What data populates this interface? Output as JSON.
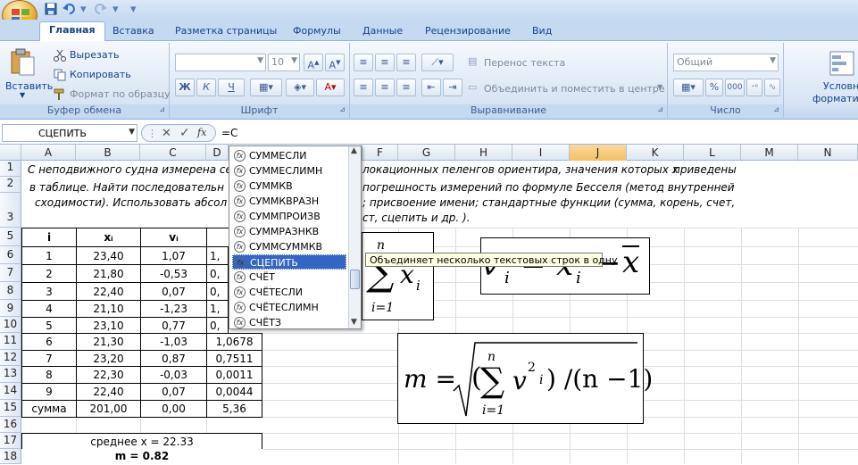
{
  "quick_access": {
    "save": "save-icon",
    "undo": "undo-icon",
    "redo": "redo-icon"
  },
  "tabs": [
    "Главная",
    "Вставка",
    "Разметка страницы",
    "Формулы",
    "Данные",
    "Рецензирование",
    "Вид"
  ],
  "ribbon": {
    "clipboard": {
      "paste": "Вставить",
      "cut": "Вырезать",
      "copy": "Копировать",
      "format_painter": "Формат по образцу",
      "label": "Буфер обмена"
    },
    "font": {
      "size": "10",
      "bold": "Ж",
      "italic": "К",
      "underline": "Ч",
      "label": "Шрифт"
    },
    "alignment": {
      "wrap": "Перенос текста",
      "merge": "Объединить и поместить в центре",
      "label": "Выравнивание"
    },
    "number": {
      "format": "Общий",
      "percent": "%",
      "thousands": "000",
      "label": "Число"
    },
    "styles": {
      "conditional_1": "Условно",
      "conditional_2": "форматиров"
    }
  },
  "formula_bar": {
    "name_box": "СЦЕПИТЬ",
    "content": "=С"
  },
  "columns": [
    "A",
    "B",
    "C",
    "D",
    "E",
    "F",
    "G",
    "H",
    "I",
    "J",
    "K",
    "L",
    "M",
    "N"
  ],
  "rows": [
    "1",
    "2",
    "3",
    "5",
    "6",
    "7",
    "8",
    "9",
    "10",
    "11",
    "12",
    "13",
    "14",
    "15",
    "16",
    "17",
    "18"
  ],
  "task_text": {
    "line1a": "С неподвижного судна измерена сер",
    "line1b": "локационных пеленгов ориентира, значения которых x",
    "line1c": " приведены",
    "line2a": "в таблице. Найти последовательн",
    "line2b": "погрешность измерений по формуле Бесселя (метод внутренней",
    "line3a": "сходимости). Использовать абсол",
    "line3b": "; присвоение имени; стандартные функции (сумма, корень, счет,",
    "line4": "ст, сцепить и др. )."
  },
  "table": {
    "headers": [
      "i",
      "xᵢ",
      "vᵢ"
    ],
    "rows": [
      [
        "1",
        "23,40",
        "1,07",
        "1,"
      ],
      [
        "2",
        "21,80",
        "-0,53",
        "0,"
      ],
      [
        "3",
        "22,40",
        "0,07",
        "0,"
      ],
      [
        "4",
        "21,10",
        "-1,23",
        "1,"
      ],
      [
        "5",
        "23,10",
        "0,77",
        "0,"
      ],
      [
        "6",
        "21,30",
        "-1,03",
        "1,0678"
      ],
      [
        "7",
        "23,20",
        "0,87",
        "0,7511"
      ],
      [
        "8",
        "22,30",
        "-0,03",
        "0,0011"
      ],
      [
        "9",
        "22,40",
        "0,07",
        "0,0044"
      ],
      [
        "сумма",
        "201,00",
        "0,00",
        "5,36"
      ]
    ],
    "mean": "среднее x = 22.33",
    "m": "m = 0.82"
  },
  "autocomplete": [
    "СУММЕСЛИ",
    "СУММЕСЛИМН",
    "СУММКВ",
    "СУММКВРАЗН",
    "СУММПРОИЗВ",
    "СУММРАЗНКВ",
    "СУММСУММКВ",
    "СЦЕПИТЬ",
    "СЧЁТ",
    "СЧЁТЕСЛИ",
    "СЧЁТЕСЛИМН",
    "СЧЁТЗ"
  ],
  "tooltip": "Объединяет несколько текстовых строк в одну",
  "formulas": {
    "sum_n": "n",
    "sum_x": "x",
    "sum_i": "i",
    "sum_lower": "i=1",
    "v": "v",
    "x": "x",
    "sub_i": "i",
    "sub_i2": "i",
    "minus": "= ",
    "m": "m =",
    "paren": "(",
    "v2": "v",
    "exp": "2",
    "ii": "i",
    "tail": ") /(n −1)",
    "n2": "n",
    "lower2": "i=1"
  }
}
